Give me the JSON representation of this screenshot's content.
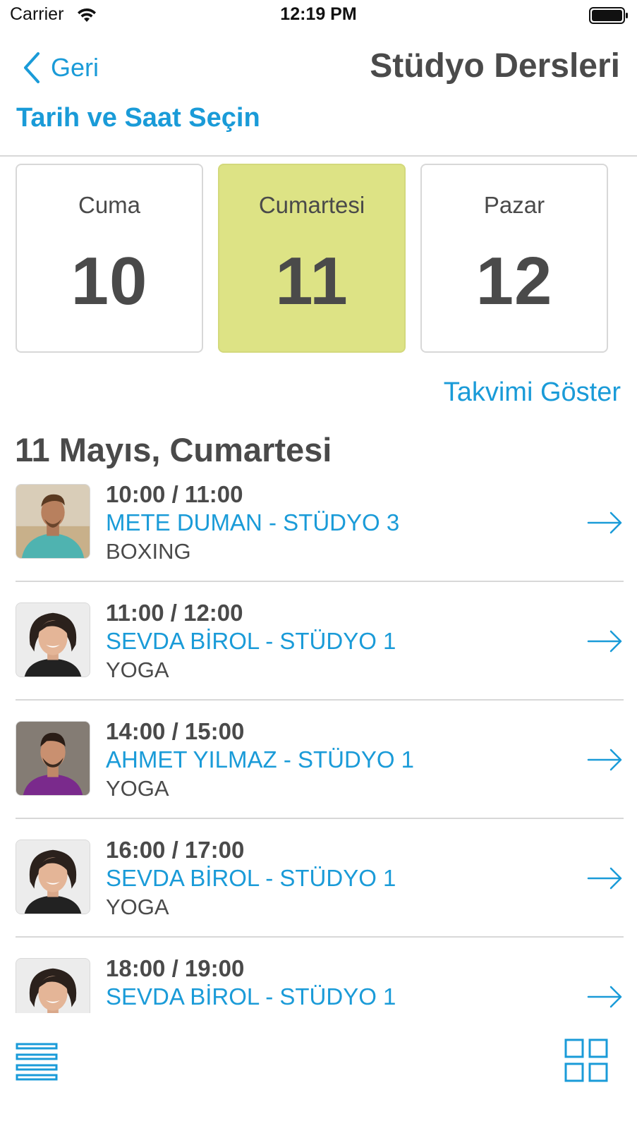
{
  "status_bar": {
    "carrier": "Carrier",
    "time": "12:19 PM",
    "wifi_icon": "wifi-icon",
    "battery_icon": "battery-icon"
  },
  "nav": {
    "back_label": "Geri",
    "back_icon": "chevron-left-icon",
    "title": "Stüdyo Dersleri"
  },
  "section_title": "Tarih ve Saat Seçin",
  "days": [
    {
      "name": "Cuma",
      "number": "10",
      "selected": false
    },
    {
      "name": "Cumartesi",
      "number": "11",
      "selected": true
    },
    {
      "name": "Pazar",
      "number": "12",
      "selected": false
    }
  ],
  "show_calendar_label": "Takvimi Göster",
  "date_heading": "11 Mayıs, Cumartesi",
  "classes": [
    {
      "time": "10:00 / 11:00",
      "trainer": "METE DUMAN - STÜDYO 3",
      "class_name": "BOXING",
      "avatar": "trainer-mete-avatar"
    },
    {
      "time": "11:00 / 12:00",
      "trainer": "SEVDA BİROL - STÜDYO 1",
      "class_name": "YOGA",
      "avatar": "trainer-sevda-avatar"
    },
    {
      "time": "14:00 / 15:00",
      "trainer": "AHMET YILMAZ - STÜDYO 1",
      "class_name": "YOGA",
      "avatar": "trainer-ahmet-avatar"
    },
    {
      "time": "16:00 / 17:00",
      "trainer": "SEVDA BİROL - STÜDYO 1",
      "class_name": "YOGA",
      "avatar": "trainer-sevda-avatar"
    },
    {
      "time": "18:00 / 19:00",
      "trainer": "SEVDA BİROL - STÜDYO 1",
      "class_name": "",
      "avatar": "trainer-sevda-avatar"
    }
  ],
  "bottom_bar": {
    "list_icon": "list-view-icon",
    "grid_icon": "grid-view-icon"
  },
  "colors": {
    "accent": "#1a9bd8",
    "selected_day": "#dde385",
    "text": "#4a4a4a",
    "divider": "#d8d8d8"
  }
}
